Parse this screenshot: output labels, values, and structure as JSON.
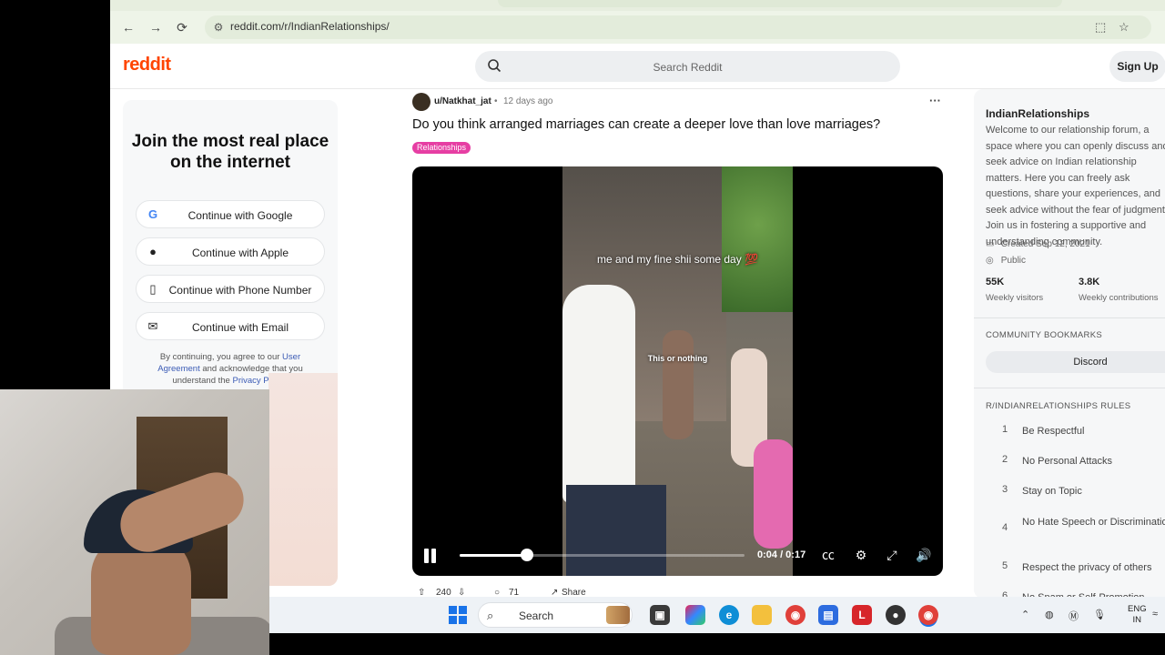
{
  "browser": {
    "url": "reddit.com/r/IndianRelationships/",
    "nav_back": "←",
    "nav_forward": "→",
    "nav_reload": "⟳"
  },
  "reddit_header": {
    "logo": "reddit",
    "search_placeholder": "Search Reddit",
    "signup_label": "Sign Up"
  },
  "join_panel": {
    "title": "Join the most real place on the internet",
    "buttons": [
      {
        "label": "Continue with Google",
        "icon": "google-icon"
      },
      {
        "label": "Continue with Apple",
        "icon": "apple-icon"
      },
      {
        "label": "Continue with Phone Number",
        "icon": "phone-icon"
      },
      {
        "label": "Continue with Email",
        "icon": "email-icon"
      }
    ],
    "legal_prefix": "By continuing, you agree to our ",
    "legal_link1": "User Agreement",
    "legal_mid": " and acknowledge that you understand the ",
    "legal_link2": "Privacy Policy",
    "legal_suffix": "."
  },
  "post": {
    "author": "u/Natkhat_jat",
    "separator": "•",
    "age": "12 days ago",
    "title": "Do you think arranged marriages can create a deeper love than love marriages?",
    "flair": "Relationships",
    "flair_color": "#e63ea3",
    "video": {
      "overlay_top": "me and my fine shii some day 💯",
      "overlay_mid": "This or nothing",
      "time": "0:04 / 0:17",
      "progress": 0.235
    },
    "votes": "240",
    "comments": "71",
    "share_label": "Share"
  },
  "sidebar": {
    "name": "IndianRelationships",
    "description": "Welcome to our relationship forum, a space where you can openly discuss and seek advice on Indian relationship matters. Here you can freely ask questions, share your experiences, and seek advice without the fear of judgment. Join us in fostering a supportive and understanding community.",
    "created": "Created Sep 12, 2021",
    "visibility": "Public",
    "stats": [
      {
        "value": "55K",
        "label": "Weekly visitors"
      },
      {
        "value": "3.8K",
        "label": "Weekly contributions"
      }
    ],
    "bookmarks_heading": "COMMUNITY BOOKMARKS",
    "bookmark": "Discord",
    "rules_heading": "R/INDIANRELATIONSHIPS RULES",
    "rules": [
      {
        "n": "1",
        "text": "Be Respectful"
      },
      {
        "n": "2",
        "text": "No Personal Attacks"
      },
      {
        "n": "3",
        "text": "Stay on Topic"
      },
      {
        "n": "4",
        "text": "No Hate Speech or Discrimination"
      },
      {
        "n": "5",
        "text": "Respect the privacy of others"
      },
      {
        "n": "6",
        "text": "No Spam or Self-Promotion"
      }
    ]
  },
  "taskbar": {
    "search_label": "Search",
    "lang_line1": "ENG",
    "lang_line2": "IN"
  },
  "colors": {
    "reddit_orange": "#ff4500",
    "link_blue": "#3b5bb5"
  }
}
